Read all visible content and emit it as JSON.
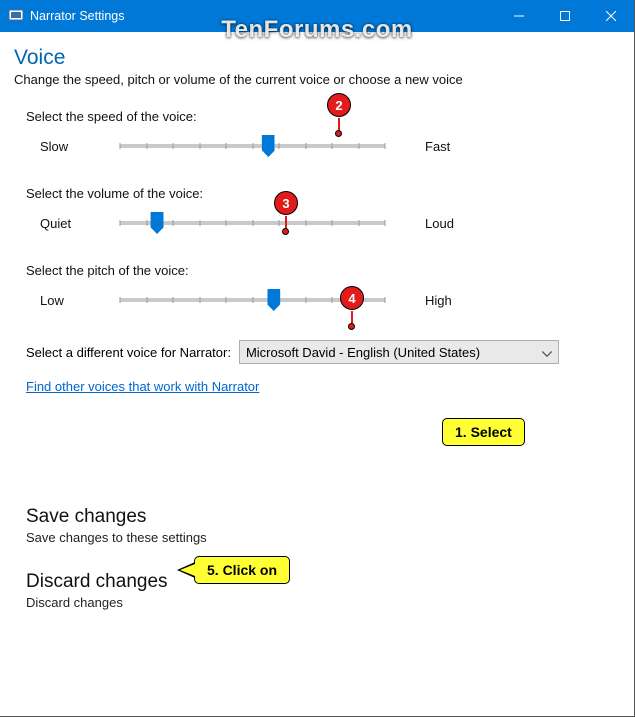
{
  "window": {
    "title": "Narrator Settings",
    "watermark": "TenForums.com"
  },
  "voice": {
    "title": "Voice",
    "subtitle": "Change the speed, pitch or volume of the current voice or choose a new voice",
    "speed": {
      "label": "Select the speed of the voice:",
      "min_label": "Slow",
      "max_label": "Fast",
      "value_pct": 56
    },
    "volume": {
      "label": "Select the volume of the voice:",
      "min_label": "Quiet",
      "max_label": "Loud",
      "value_pct": 14
    },
    "pitch": {
      "label": "Select the pitch of the voice:",
      "min_label": "Low",
      "max_label": "High",
      "value_pct": 58
    },
    "select_voice_label": "Select a different voice for Narrator:",
    "selected_voice": "Microsoft David - English (United States)",
    "link": "Find other voices that work with Narrator"
  },
  "actions": {
    "save_title": "Save changes",
    "save_sub": "Save changes to these settings",
    "discard_title": "Discard changes",
    "discard_sub": "Discard changes"
  },
  "annotations": {
    "b2": "2",
    "b3": "3",
    "b4": "4",
    "c1": "1. Select",
    "c5": "5. Click on"
  }
}
